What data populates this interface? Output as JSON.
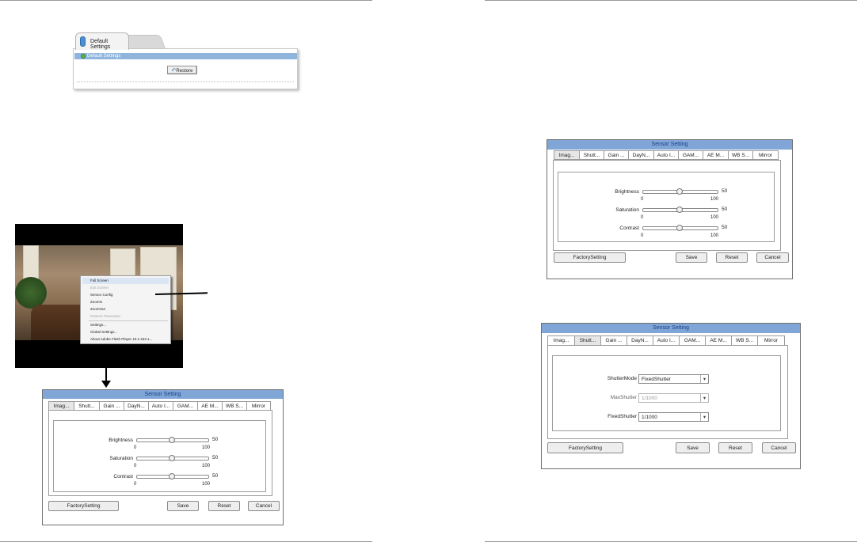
{
  "default_settings": {
    "tab_label": "Default Settings",
    "section_label": "Default Settings",
    "restore_label": "Restore"
  },
  "context_menu": {
    "items": [
      {
        "label": "Full Screen",
        "enabled": true
      },
      {
        "label": "Exit Screen",
        "enabled": false
      },
      {
        "label": "Sensor Config",
        "enabled": true
      },
      {
        "label": "ZoomIn",
        "enabled": true
      },
      {
        "label": "ZoomOut",
        "enabled": true
      },
      {
        "label": "Restore Panorama",
        "enabled": false
      },
      {
        "label": "Settings...",
        "enabled": true
      },
      {
        "label": "Global Settings...",
        "enabled": true
      },
      {
        "label": "About Adobe Flash Player 10.2.153.1...",
        "enabled": true
      }
    ]
  },
  "sensor_dialog": {
    "title": "Sensor Setting",
    "tabs": [
      "Imag...",
      "Shutt...",
      "Gain ...",
      "DayN...",
      "Auto I...",
      "GAM...",
      "AE M...",
      "WB S...",
      "Mirror"
    ],
    "image_sliders": [
      {
        "label": "Brightness",
        "value": "50",
        "min": "0",
        "max": "100",
        "level": 0.5
      },
      {
        "label": "Saturation",
        "value": "50",
        "min": "0",
        "max": "100",
        "level": 0.5
      },
      {
        "label": "Contrast",
        "value": "50",
        "min": "0",
        "max": "100",
        "level": 0.5
      }
    ],
    "shutter_fields": [
      {
        "label": "ShutterMode",
        "value": "FixedShutter",
        "enabled": true
      },
      {
        "label": "MaxShutter",
        "value": "1/1000",
        "enabled": false
      },
      {
        "label": "FixedShutter",
        "value": "1/1000",
        "enabled": true
      }
    ],
    "buttons": {
      "factory": "FactorySetting",
      "save": "Save",
      "reset": "Reset",
      "cancel": "Cancel"
    }
  },
  "icons": {
    "restore": "undo-arrow-icon",
    "dropdown": "chevron-down-icon"
  },
  "colors": {
    "title_bar": "#7fa6d6",
    "section_bar": "#8fb5dc",
    "tab_pill": "#4d8fd0"
  }
}
